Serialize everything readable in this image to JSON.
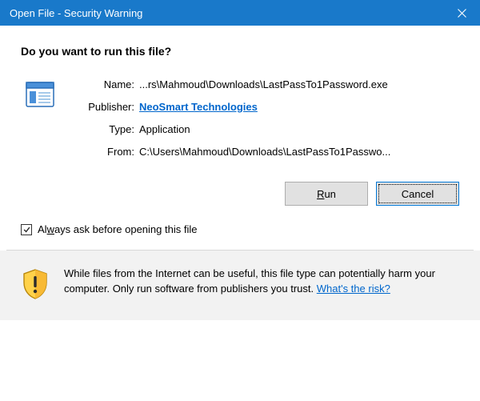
{
  "titlebar": {
    "title": "Open File - Security Warning"
  },
  "heading": "Do you want to run this file?",
  "details": {
    "name_label": "Name:",
    "name_value": "...rs\\Mahmoud\\Downloads\\LastPassTo1Password.exe",
    "publisher_label": "Publisher:",
    "publisher_value": "NeoSmart Technologies",
    "type_label": "Type:",
    "type_value": "Application",
    "from_label": "From:",
    "from_value": "C:\\Users\\Mahmoud\\Downloads\\LastPassTo1Passwo..."
  },
  "buttons": {
    "run_prefix": "R",
    "run_suffix": "un",
    "cancel": "Cancel"
  },
  "checkbox": {
    "checked": true,
    "label_prefix": "Al",
    "label_mnemonic": "w",
    "label_suffix": "ays ask before opening this file"
  },
  "footer": {
    "text": "While files from the Internet can be useful, this file type can potentially harm your computer. Only run software from publishers you trust. ",
    "risk_link": "What's the risk?"
  },
  "colors": {
    "titlebar_bg": "#1979ca",
    "link": "#0066cc",
    "footer_bg": "#f2f2f2"
  }
}
